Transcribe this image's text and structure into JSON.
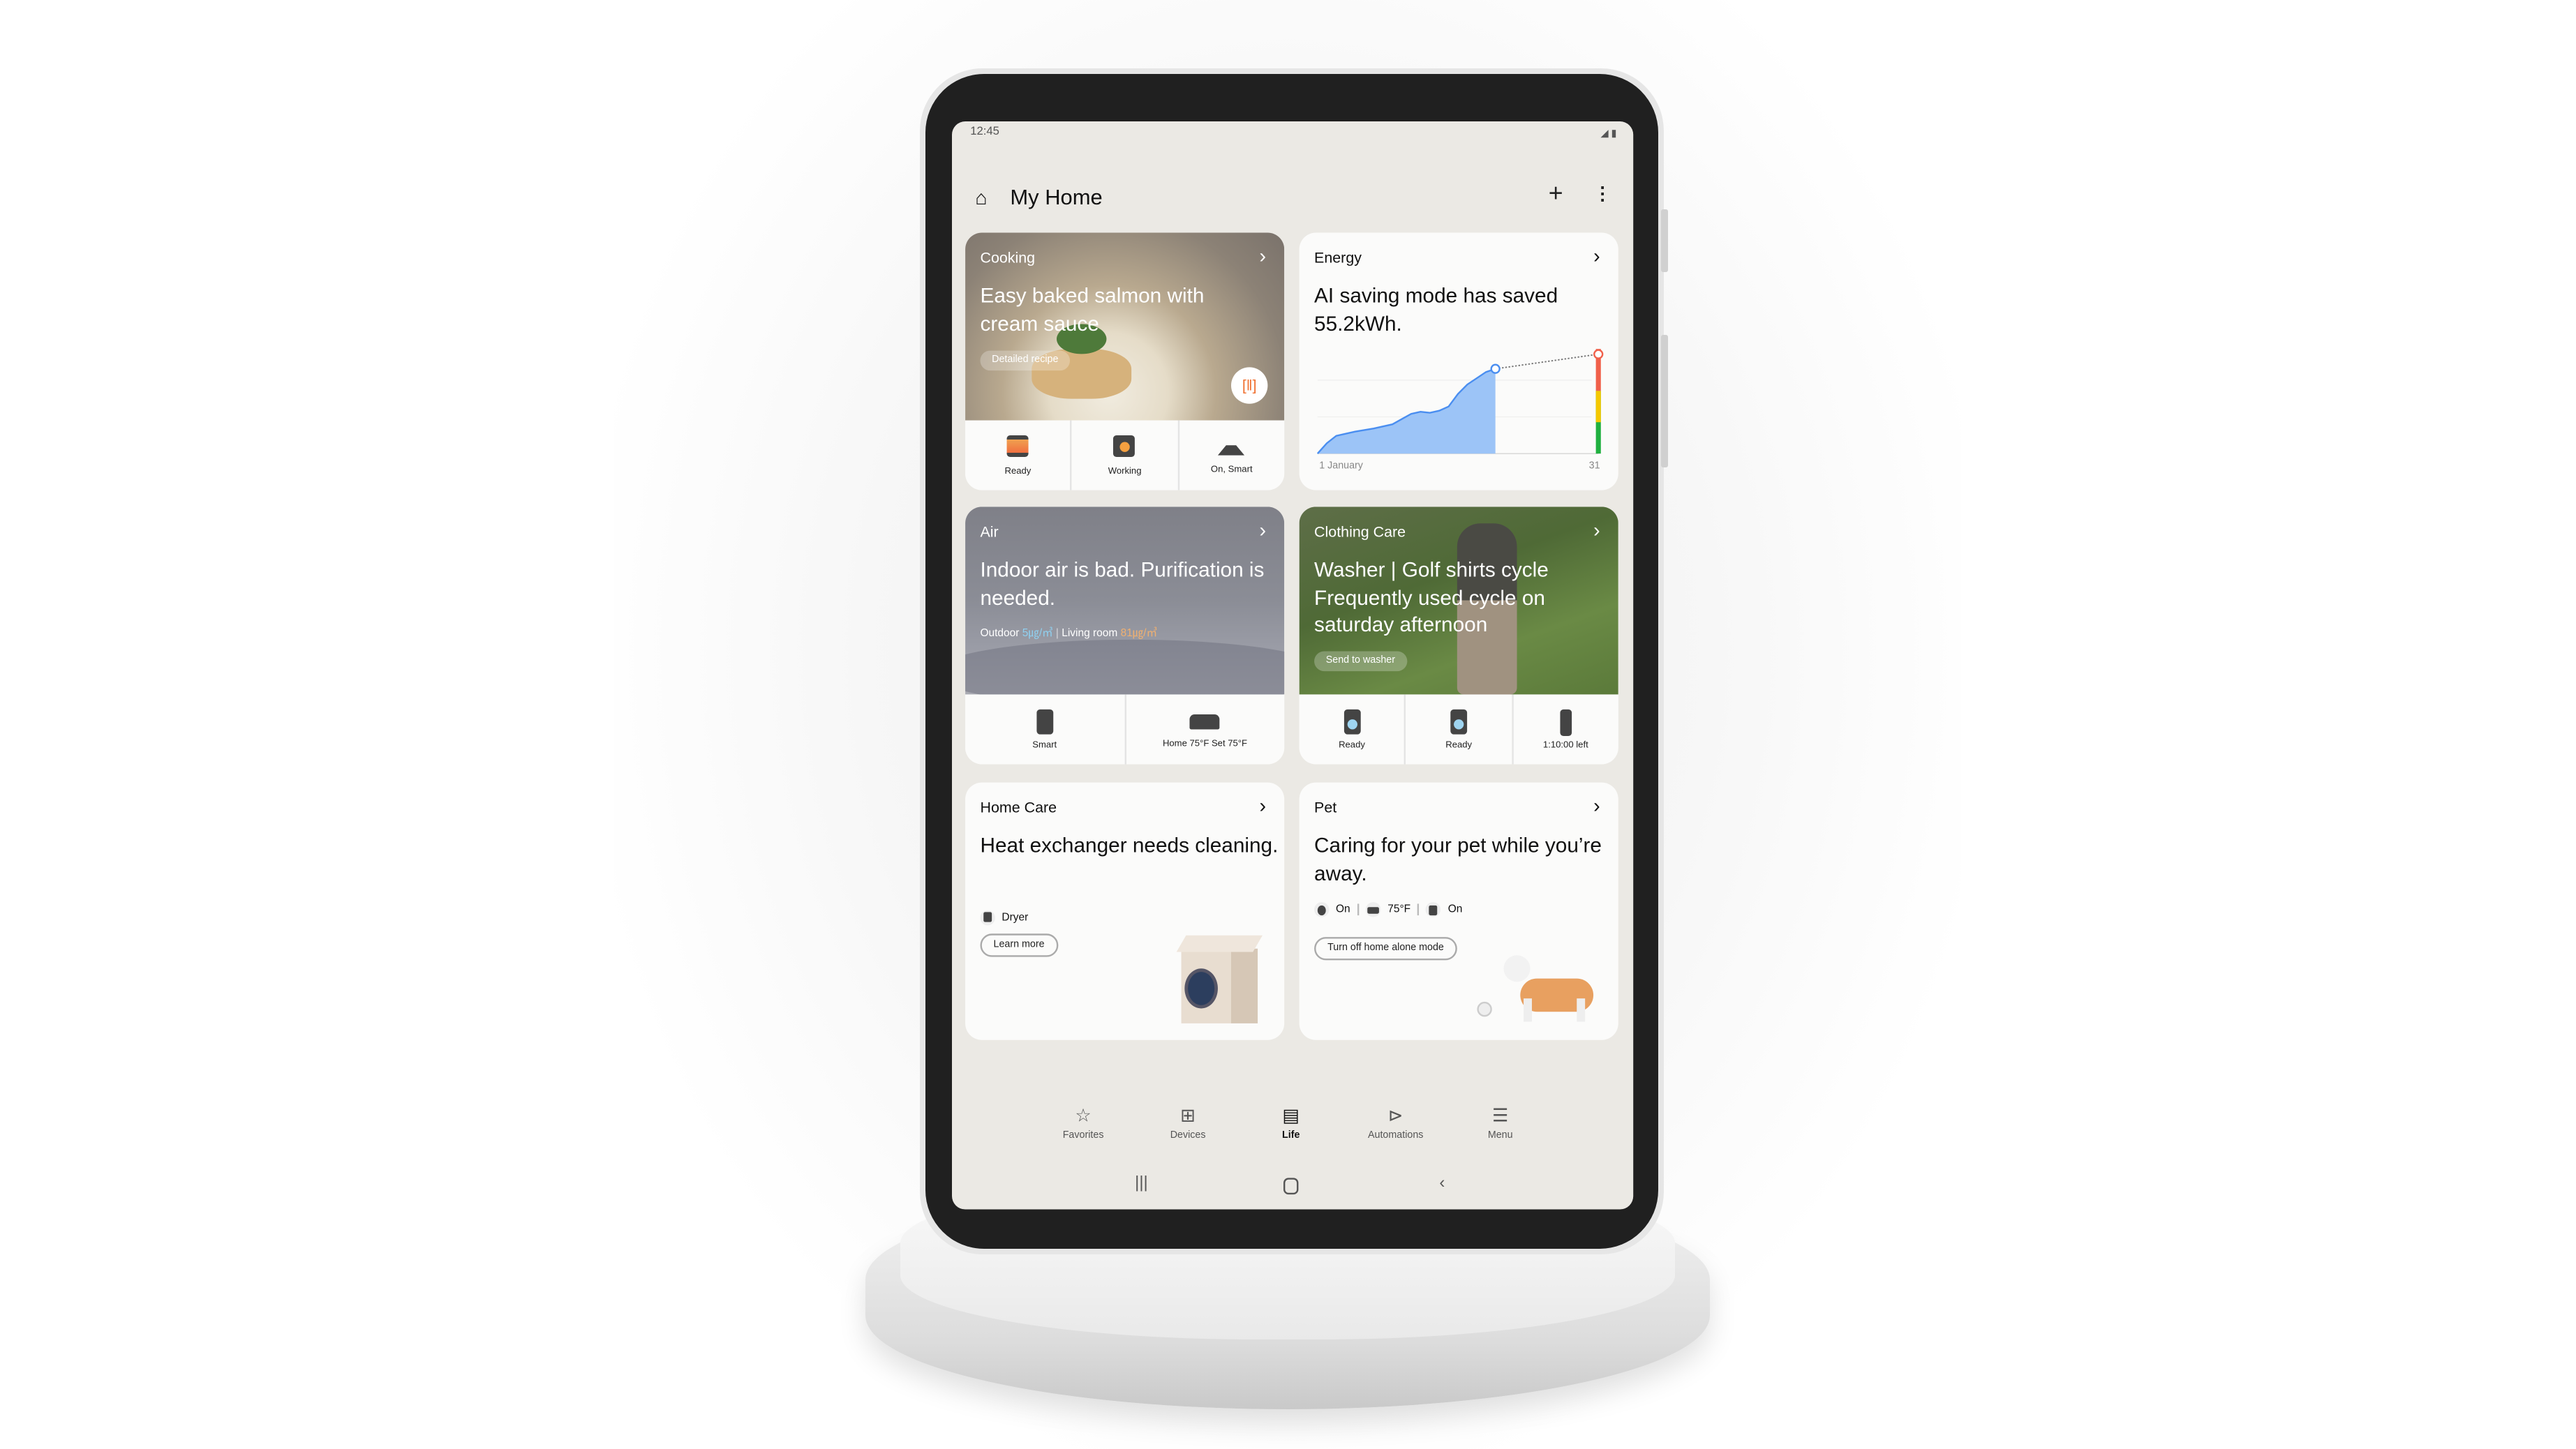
{
  "status_bar": {
    "time": "12:45",
    "signal_icon": "signal-icon",
    "battery_icon": "battery-icon"
  },
  "header": {
    "title": "My Home",
    "home_icon": "home-icon",
    "add_icon": "plus-icon",
    "more_icon": "more-vert-icon"
  },
  "cards": {
    "cooking": {
      "label": "Cooking",
      "title": "Easy baked salmon with cream sauce",
      "button": "Detailed recipe",
      "scan_icon": "barcode-scan-icon",
      "devices": [
        {
          "icon": "oven-icon",
          "status": "Ready"
        },
        {
          "icon": "cooktop-icon",
          "status": "Working"
        },
        {
          "icon": "range-hood-icon",
          "status": "On, Smart"
        }
      ]
    },
    "energy": {
      "label": "Energy",
      "title": "AI saving mode has saved 55.2kWh.",
      "x_start": "1 January",
      "x_end": "31"
    },
    "air": {
      "label": "Air",
      "title": "Indoor air is bad. Purification is needed.",
      "outdoor_label": "Outdoor",
      "outdoor_value": "5㎍/㎥",
      "room_label": "Living room",
      "room_value": "81㎍/㎥",
      "outdoor_color": "#8fd0f0",
      "room_color": "#f0b070",
      "devices": [
        {
          "icon": "air-purifier-icon",
          "status": "Smart"
        },
        {
          "icon": "air-conditioner-icon",
          "status": "Home 75°F Set 75°F"
        }
      ]
    },
    "clothing": {
      "label": "Clothing Care",
      "title": "Washer | Golf shirts cycle Frequently used cycle on saturday afternoon",
      "button": "Send to washer",
      "devices": [
        {
          "icon": "washer-icon",
          "status": "Ready"
        },
        {
          "icon": "dryer-icon",
          "status": "Ready"
        },
        {
          "icon": "airdresser-icon",
          "status": "1:10:00 left"
        }
      ]
    },
    "home_care": {
      "label": "Home Care",
      "title": "Heat exchanger needs cleaning.",
      "device": "Dryer",
      "button": "Learn more"
    },
    "pet": {
      "label": "Pet",
      "title": "Caring for your pet while you’re away.",
      "statuses": [
        {
          "icon": "robot-vacuum-icon",
          "value": "On"
        },
        {
          "icon": "air-conditioner-icon",
          "value": "75°F"
        },
        {
          "icon": "air-purifier-icon",
          "value": "On"
        }
      ],
      "button": "Turn off home alone mode"
    }
  },
  "nav": [
    {
      "label": "Favorites",
      "icon": "star-icon"
    },
    {
      "label": "Devices",
      "icon": "devices-icon"
    },
    {
      "label": "Life",
      "icon": "life-icon",
      "active": true
    },
    {
      "label": "Automations",
      "icon": "play-circle-icon"
    },
    {
      "label": "Menu",
      "icon": "menu-icon"
    }
  ],
  "chart_data": {
    "type": "area",
    "x": [
      1,
      2,
      3,
      5,
      7,
      9,
      10,
      11,
      12,
      13,
      14,
      15,
      16,
      17,
      18,
      19,
      20
    ],
    "values": [
      0,
      10,
      17,
      21,
      24,
      28,
      33,
      38,
      40,
      39,
      41,
      45,
      57,
      66,
      72,
      78,
      81
    ],
    "projection": {
      "x": [
        20,
        31
      ],
      "values": [
        81,
        95
      ]
    },
    "xlim": [
      1,
      31
    ],
    "ylim": [
      0,
      100
    ],
    "x_tick_labels": [
      "1 January",
      "31"
    ],
    "fill_color": "#9cc4f7",
    "line_color": "#4a8ef0",
    "gauge_colors": [
      "#20b040",
      "#f5c800",
      "#f0604a"
    ],
    "grid": true
  }
}
